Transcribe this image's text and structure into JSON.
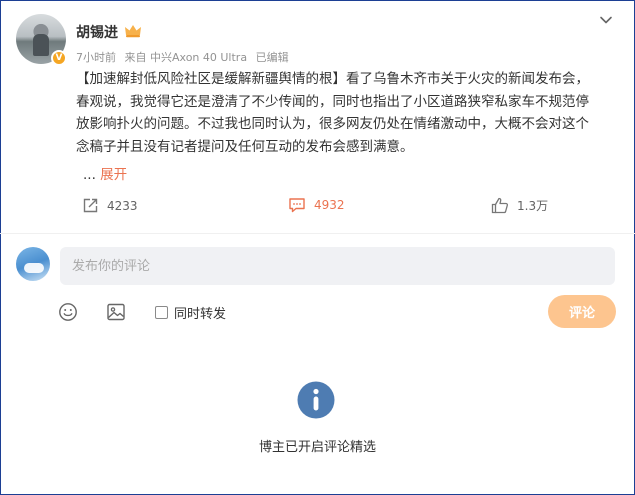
{
  "post": {
    "username": "胡锡进",
    "verified_badge": "V",
    "member_icon": "crown-member-icon",
    "time": "7小时前",
    "source": "来自 中兴Axon 40 Ultra",
    "edited": "已编辑",
    "content_lines": [
      "【加速解封低风险社区是缓解新疆舆情的根】看了乌鲁木齐市关于火灾的新闻发布会，",
      "春观说，我觉得它还是澄清了不少传闻的，同时也指出了小区道路狭窄私家车不规范停",
      "放影响扑火的问题。不过我也同时认为，很多网友仍处在情绪激动中，大概不会对这个",
      "念稿子并且没有记者提问及任何互动的发布会感到满意。"
    ],
    "ellipsis": "...",
    "expand_label": "展开"
  },
  "actions": {
    "repost_count": "4233",
    "comment_count": "4932",
    "like_count": "1.3万"
  },
  "composer": {
    "placeholder": "发布你的评论",
    "repost_label": "同时转发",
    "submit_label": "评论"
  },
  "notice": {
    "text": "博主已开启评论精选"
  },
  "colors": {
    "accent": "#eb7350",
    "submit_disabled": "#fdc58f",
    "info_icon": "#4e7cb2",
    "input_bg": "#f0f1f4"
  }
}
